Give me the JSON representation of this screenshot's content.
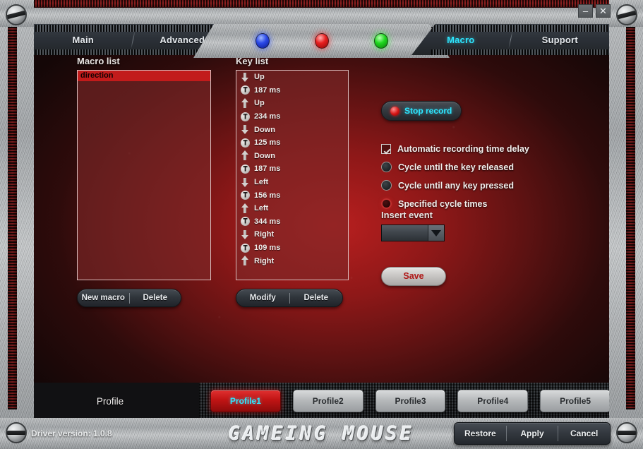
{
  "window": {
    "minimize_label": "–",
    "close_label": "✕"
  },
  "tabs": {
    "left": [
      {
        "label": "Main",
        "active": false
      },
      {
        "label": "Advanced",
        "active": false
      }
    ],
    "right": [
      {
        "label": "Macro",
        "active": true
      },
      {
        "label": "Support",
        "active": false
      }
    ],
    "leds": [
      {
        "name": "led-blue",
        "color": "#2b49e8"
      },
      {
        "name": "led-red",
        "color": "#e81f1f"
      },
      {
        "name": "led-green",
        "color": "#1fd81f"
      }
    ]
  },
  "macro_panel": {
    "title": "Macro list",
    "items": [
      {
        "label": "direction",
        "selected": true
      }
    ],
    "buttons": [
      {
        "label": "New macro"
      },
      {
        "label": "Delete"
      }
    ]
  },
  "key_panel": {
    "title": "Key list",
    "items": [
      {
        "icon": "arrow-down-icon",
        "label": "Up"
      },
      {
        "icon": "time-icon",
        "label": "187 ms"
      },
      {
        "icon": "arrow-up-icon",
        "label": "Up"
      },
      {
        "icon": "time-icon",
        "label": "234 ms"
      },
      {
        "icon": "arrow-down-icon",
        "label": "Down"
      },
      {
        "icon": "time-icon",
        "label": "125 ms"
      },
      {
        "icon": "arrow-up-icon",
        "label": "Down"
      },
      {
        "icon": "time-icon",
        "label": "187 ms"
      },
      {
        "icon": "arrow-down-icon",
        "label": "Left"
      },
      {
        "icon": "time-icon",
        "label": "156 ms"
      },
      {
        "icon": "arrow-up-icon",
        "label": "Left"
      },
      {
        "icon": "time-icon",
        "label": "344 ms"
      },
      {
        "icon": "arrow-down-icon",
        "label": "Right"
      },
      {
        "icon": "time-icon",
        "label": "109 ms"
      },
      {
        "icon": "arrow-up-icon",
        "label": "Right"
      }
    ],
    "buttons": [
      {
        "label": "Modify"
      },
      {
        "label": "Delete"
      }
    ]
  },
  "record_panel": {
    "stop_record_label": "Stop record",
    "options": [
      {
        "type": "checkbox",
        "label": "Automatic recording time delay",
        "checked": true
      },
      {
        "type": "radio",
        "label": "Cycle until the key released",
        "selected": false
      },
      {
        "type": "radio",
        "label": "Cycle until any key pressed",
        "selected": false
      },
      {
        "type": "radio",
        "label": "Specified cycle times",
        "selected": true
      }
    ],
    "insert_event_title": "Insert event",
    "insert_event_value": "",
    "save_label": "Save"
  },
  "profile_bar": {
    "label": "Profile",
    "profiles": [
      {
        "label": "Profile1",
        "active": true
      },
      {
        "label": "Profile2",
        "active": false
      },
      {
        "label": "Profile3",
        "active": false
      },
      {
        "label": "Profile4",
        "active": false
      },
      {
        "label": "Profile5",
        "active": false
      }
    ]
  },
  "footer": {
    "driver_version": "Driver version:  1.0.8",
    "logo": "GAMEING MOUSE",
    "actions": [
      {
        "label": "Restore"
      },
      {
        "label": "Apply"
      },
      {
        "label": "Cancel"
      }
    ]
  },
  "colors": {
    "accent_cyan": "#2ee6ff",
    "accent_red": "#c21b1b",
    "panel_red": "#8e1818"
  }
}
